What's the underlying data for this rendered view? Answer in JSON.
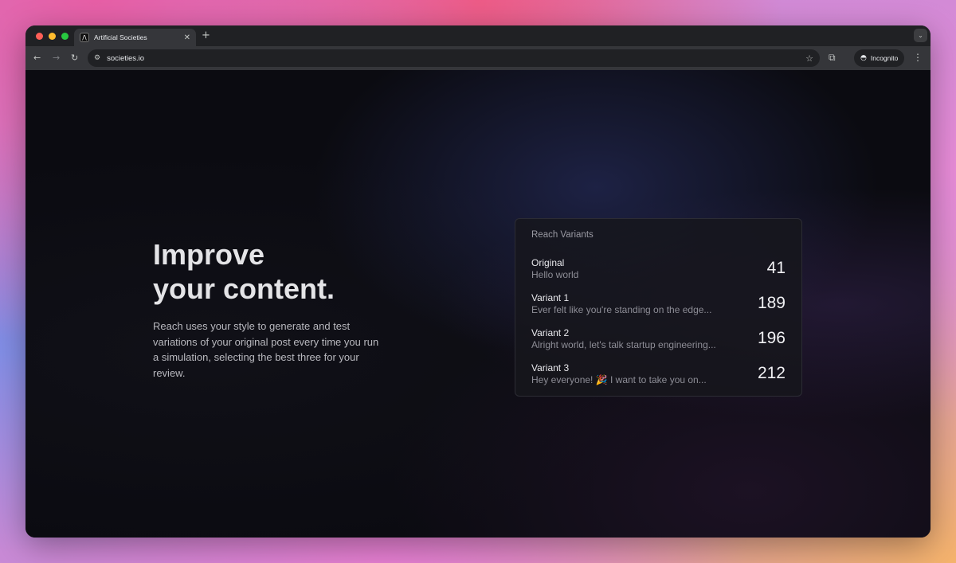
{
  "browser": {
    "tab_title": "Artificial Societies",
    "favicon_letter": "/\\",
    "url": "societies.io",
    "incognito_label": "Incognito"
  },
  "hero": {
    "headline_line1": "Improve",
    "headline_line2": "your content.",
    "description": "Reach uses your style to generate and test variations of your original post every time you run a simulation, selecting the best three for your review."
  },
  "card": {
    "title": "Reach Variants",
    "variants": [
      {
        "name": "Original",
        "text": "Hello world",
        "count": "41"
      },
      {
        "name": "Variant 1",
        "text": "Ever felt like you're standing on the edge...",
        "count": "189"
      },
      {
        "name": "Variant 2",
        "text": "Alright world, let's talk startup engineering...",
        "count": "196"
      },
      {
        "name": "Variant 3",
        "text": "Hey everyone! 🎉 I want to take you on...",
        "count": "212"
      }
    ]
  },
  "icons": {
    "back": "back-arrow-icon",
    "forward": "forward-arrow-icon",
    "reload": "reload-icon",
    "bookmark": "star-icon",
    "extensions": "puzzle-icon",
    "menu": "kebab-menu-icon"
  }
}
